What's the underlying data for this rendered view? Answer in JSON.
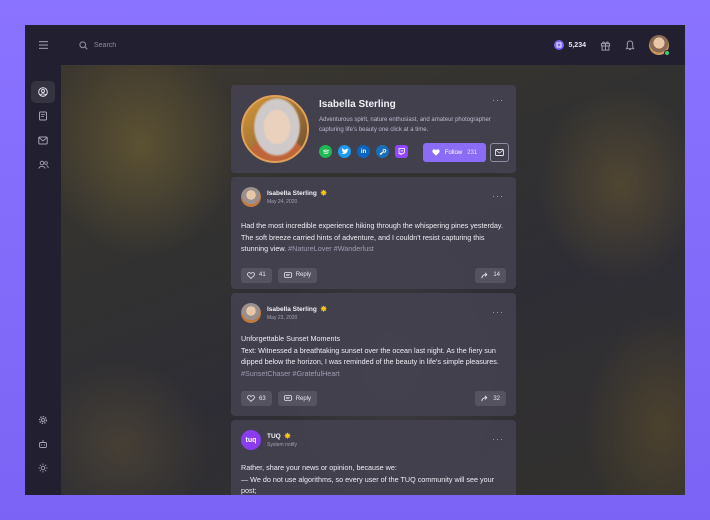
{
  "topbar": {
    "search_placeholder": "Search",
    "coins": "5,234"
  },
  "profile": {
    "name": "Isabella Sterling",
    "bio": "Adventurous spirit, nature enthusiast, and amateur photographer capturing life's beauty one click at a time.",
    "socials": [
      "spotify-icon",
      "twitter-icon",
      "linkedin-icon",
      "steam-icon",
      "twitch-icon"
    ],
    "follow_label": "Follow",
    "follow_count": "231",
    "more": "···"
  },
  "posts": [
    {
      "author": "Isabella Sterling",
      "date": "May 24, 2020",
      "text": "Had the most incredible experience hiking through the whispering pines yesterday. The soft breeze carried hints of adventure, and I couldn't resist capturing this stunning view.",
      "tags": "#NatureLover #Wanderlust",
      "likes": "41",
      "reply_label": "Reply",
      "shares": "14",
      "more": "···"
    },
    {
      "author": "Isabella Sterling",
      "date": "May 23, 2020",
      "title": "Unforgettable Sunset Moments",
      "text": "Text: Witnessed a breathtaking sunset over the ocean last night. As the fiery sun dipped below the horizon, I was reminded of the beauty in life's simple pleasures.",
      "tags": "#SunsetChaser #GratefulHeart",
      "likes": "63",
      "reply_label": "Reply",
      "shares": "32",
      "more": "···"
    },
    {
      "author": "TUQ",
      "avatar_text": "tuq",
      "date": "System notify",
      "line1": "Rather, share your news or opinion, because we:",
      "line2": "— We do not use algorithms, so every user of the TUQ community will see your post;",
      "more": "···"
    }
  ],
  "colors": {
    "accent": "#8b6cf7",
    "brand_bg": "#7b63f5",
    "card": "#44424f",
    "app_bg": "#25232f"
  }
}
